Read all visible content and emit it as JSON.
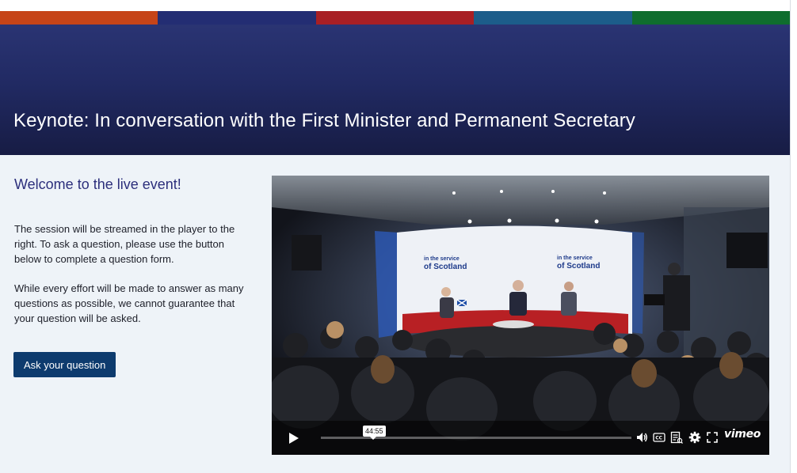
{
  "brand_bar": {
    "colors": [
      "#c64418",
      "#232d73",
      "#a81f24",
      "#1c5d8a",
      "#0f6d2e"
    ]
  },
  "hero": {
    "title": "Keynote: In conversation with the First Minister and Permanent Secretary",
    "background": "#212a63"
  },
  "intro": {
    "heading": "Welcome to the live event!",
    "paragraph_1": "The session will be streamed in the player to the right. To ask a question, please use the button below to complete a question form.",
    "paragraph_2": "While every effort will be made to answer as many questions as possible, we cannot guarantee that your question will be asked.",
    "ask_button": "Ask your question",
    "button_color": "#0d3b6e"
  },
  "video": {
    "stage_sign_text": [
      "in the service",
      "of Scotland"
    ],
    "time_tooltip": "44:55",
    "progress_fraction": 0.0,
    "icons": [
      "play-icon",
      "volume-icon",
      "closed-captions-icon",
      "transcript-icon",
      "settings-icon",
      "fullscreen-icon"
    ],
    "brand": "vimeo"
  }
}
